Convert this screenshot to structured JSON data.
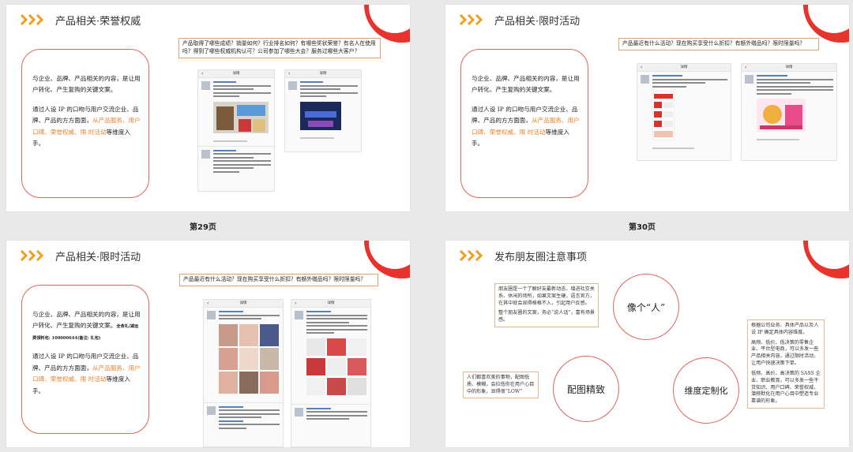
{
  "pages": {
    "p29": "第29页",
    "p30": "第30页"
  },
  "slide29": {
    "title": "产品相关·荣誉权威",
    "card": {
      "para1": "与企业、品牌、产品相关的内容，是让用户转化、产生复购的关键文案。",
      "para2_pre": "通过人设 IP 的口吻与用户交流企业、品牌、产品的方方面面，",
      "para2_hl": "从产品服务、用户口碑、荣誉权威、限 时活动",
      "para2_post": "等维度入手。"
    },
    "question": "产品取得了哪些成绩？销量如何？行业排名如何？有哪些奖状荣誉？有名人在使用吗？得到了哪些权威机构认可？公司参加了哪些大会？服务过哪些大客户？",
    "phone_title": "详情"
  },
  "slide30": {
    "title": "产品相关·限时活动",
    "card": {
      "para1": "与企业、品牌、产品相关的内容，是让用户转化、产生复购的关键文案。",
      "para2_pre": "通过人设 IP 的口吻与用户交流企业、品牌、产品的方方面面，",
      "para2_hl": "从产品服务、用户口碑、荣誉权威、限 时活动",
      "para2_post": "等维度入手。"
    },
    "question": "产品最近有什么活动？现在购买享受什么折扣？有额外赠品吗？限时限量吗？",
    "phone_title": "详情"
  },
  "slide31": {
    "title": "产品相关·限时活动",
    "card": {
      "para1": "与企业、品牌、产品相关的内容，是让用户转化、产生复购的关键文案。",
      "note": "全食礼/减运费领料包: 100000644(备注: 礼包)",
      "para2_pre": "通过人设 IP 的口吻与用户交流企业、品牌、产品的方方面面，",
      "para2_hl": "从产品服务、用户口碑、荣誉权威、限 时活动",
      "para2_post": "等维度入手。"
    },
    "question": "产品最近有什么活动？现在购买享受什么折扣？有额外赠品吗？限时限量吗？",
    "phone_title": "详情"
  },
  "slide32": {
    "title": "发布朋友圈注意事项",
    "bubble1": "像个“人”",
    "bubble2": "配图精致",
    "bubble3": "维度定制化",
    "note1_p1": "朋友圈是一个了解好友最新动态、增进社交关系、休闲的场所，如果文案生硬，语言官方，在其中就会显得格格不入，引起用户反感。",
    "note1_p2": "整个朋友圈的文案，务必“说人话”，富有场景感。",
    "note2": "人们都喜欢美的事物，配图低质、模糊，会拉低你在用户心目中的形象，显得很“LOW”",
    "note3_p1": "根据公司业务、具体产品以及人设 IP 确定具体内容维度。",
    "note3_p2": "高频、低价、低决策的零售企业、平台型电商，可以多发一些产品相关内容，通过限时活动，让用户快速决策下单。",
    "note3_p3": "低频、高价、高决策的 SASS 企业、职业教育，可以多发一些干货知识、用户口碑、荣誉权威，潜移默化在用户心目中塑造专业靠谱的形象。"
  },
  "colors": {
    "accent_red": "#e8322c",
    "chevron_orange": "#f0a020",
    "highlight": "#e8822c"
  }
}
